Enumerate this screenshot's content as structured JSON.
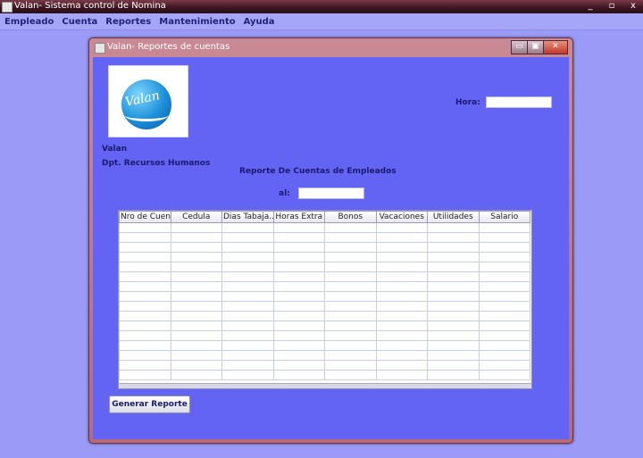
{
  "app": {
    "title": "Valan- Sistema control de Nomina",
    "window_buttons": [
      "_",
      "▫",
      "x"
    ]
  },
  "menu": {
    "items": [
      "Empleado",
      "Cuenta",
      "Reportes",
      "Mantenimiento",
      "Ayuda"
    ]
  },
  "frame": {
    "title": "Valan- Reportes de cuentas",
    "buttons": [
      "▭",
      "▣",
      "✕"
    ]
  },
  "logo": {
    "text": "Valan"
  },
  "company": {
    "name": "Valan",
    "department": "Dpt. Recursos Humanos"
  },
  "hora": {
    "label": "Hora:",
    "value": ""
  },
  "report": {
    "title": "Reporte De Cuentas de Empleados",
    "date_label": "al:",
    "date_value": ""
  },
  "table": {
    "columns": [
      "Nro de Cuenta",
      "Cedula",
      "Dias Tabaja...",
      "Horas Extra",
      "Bonos",
      "Vacaciones",
      "Utilidades",
      "Salario"
    ],
    "rows": []
  },
  "actions": {
    "generate_label": "Generar Reporte"
  },
  "colors": {
    "frame_bg": "#6363f4",
    "desktop_bg": "#9b9bf7",
    "title_accent": "#c98a95"
  }
}
